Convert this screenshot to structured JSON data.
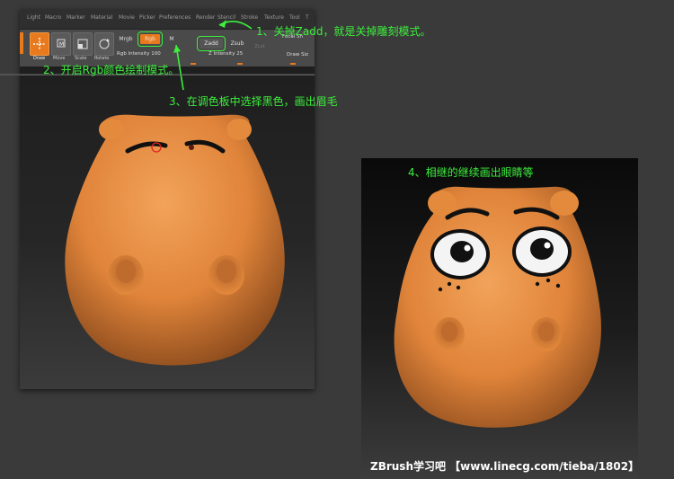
{
  "menu": [
    "Light",
    "Macro",
    "Marker",
    "Material",
    "Movie",
    "Picker",
    "Preferences",
    "Render",
    "Stencil",
    "Stroke",
    "Texture",
    "Tool",
    "T"
  ],
  "toolbar": {
    "draw": "Draw",
    "move": "Move",
    "scale": "Scale",
    "rotate": "Rotate",
    "mrgb": "Mrgb",
    "rgb": "Rgb",
    "m": "M",
    "zadd": "Zadd",
    "zsub": "Zsub",
    "zcut": "Zcut",
    "focal_shift": "Focal Sh",
    "draw_size": "Draw Siz",
    "rgb_intensity": "Rgb Intensity 100",
    "z_intensity": "Z Intensity 25"
  },
  "annotations": {
    "step1": "1、关掉Zadd，就是关掉雕刻模式。",
    "step2": "2、开启Rgb颜色绘制模式。",
    "step3": "3、在调色板中选择黑色，画出眉毛",
    "step4": "4、相继的继续画出眼睛等"
  },
  "footer": "ZBrush学习吧 【www.linecg.com/tieba/1802】",
  "colors": {
    "annotation": "#3cf03c",
    "skin": "#e48a3c",
    "accent": "#e87a1d"
  }
}
